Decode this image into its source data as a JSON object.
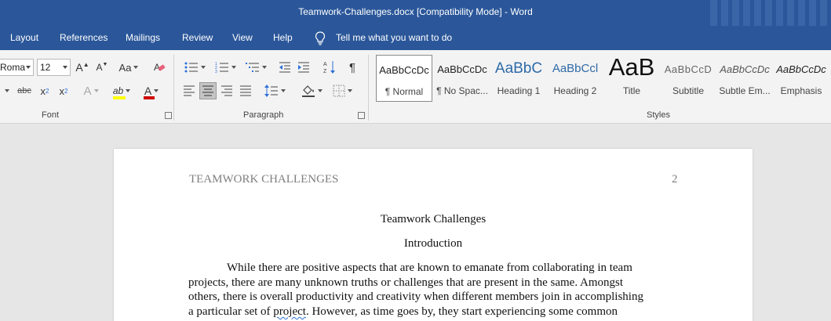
{
  "titlebar": {
    "text": "Teamwork-Challenges.docx [Compatibility Mode]  -  Word"
  },
  "menu": {
    "tabs": [
      "Layout",
      "References",
      "Mailings",
      "Review",
      "View",
      "Help"
    ],
    "tell_me": "Tell me what you want to do"
  },
  "ribbon": {
    "font": {
      "font_name": "Roma",
      "font_size": "12",
      "grow": "A",
      "shrink": "A",
      "change_case": "Aa",
      "strikethrough": "abc",
      "subscript": "x",
      "subscript_mark": "2",
      "superscript": "x",
      "superscript_mark": "2",
      "effects": "A",
      "highlight": "ab",
      "font_color": "A",
      "label": "Font",
      "highlight_color": "#ffff00",
      "font_color_value": "#d00000"
    },
    "paragraph": {
      "label": "Paragraph",
      "show_marks": "¶"
    },
    "styles": {
      "label": "Styles",
      "items": [
        {
          "preview": "AaBbCcDc",
          "name": "¶ Normal"
        },
        {
          "preview": "AaBbCcDc",
          "name": "¶ No Spac..."
        },
        {
          "preview": "AaBbC",
          "name": "Heading 1"
        },
        {
          "preview": "AaBbCcl",
          "name": "Heading 2"
        },
        {
          "preview": "AaB",
          "name": "Title"
        },
        {
          "preview": "AaBbCcD",
          "name": "Subtitle"
        },
        {
          "preview": "AaBbCcDc",
          "name": "Subtle Em..."
        },
        {
          "preview": "AaBbCcDc",
          "name": "Emphasis"
        }
      ]
    }
  },
  "document": {
    "header_left": "TEAMWORK CHALLENGES",
    "header_right": "2",
    "title": "Teamwork Challenges",
    "heading": "Introduction",
    "lines": [
      "While there are positive aspects that are known to emanate from collaborating in team",
      "projects, there are many unknown truths or challenges that are present in the same. Amongst",
      "others, there is overall productivity and creativity when different members join in accomplishing"
    ],
    "last_line": {
      "before": "a particular set of ",
      "flagged": "project",
      "after": ". However, as time goes by, they start experiencing some common"
    }
  },
  "colors": {
    "word_blue": "#2b579a",
    "ribbon_bg": "#f3f3f3",
    "canvas_bg": "#e6e6e6"
  }
}
